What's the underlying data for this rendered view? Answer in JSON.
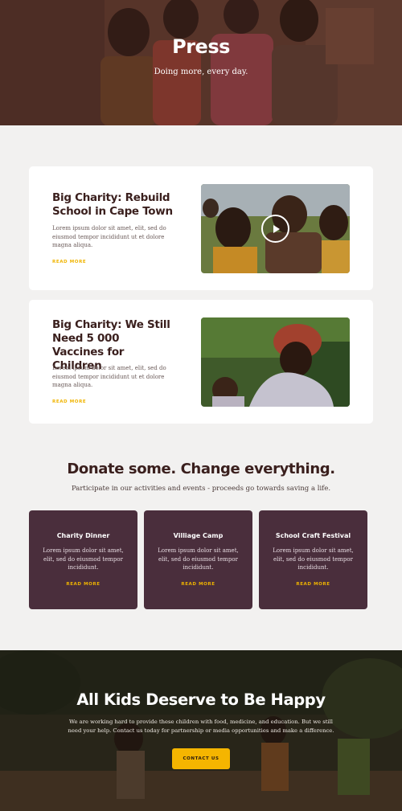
{
  "hero": {
    "title": "Press",
    "subtitle": "Doing more, every day."
  },
  "articles": [
    {
      "title": "Big Charity: Rebuild School in Cape Town",
      "body": "Lorem ipsum dolor sit amet, elit, sed do eiusmod tempor incididunt ut et dolore magna aliqua.",
      "link": "READ MORE",
      "media": "video"
    },
    {
      "title": "Big Charity: We Still Need 5 000 Vaccines for Children",
      "body": "Lorem ipsum dolor sit amet, elit, sed do eiusmod tempor incididunt ut et dolore magna aliqua.",
      "link": "READ MORE",
      "media": "image"
    }
  ],
  "donate": {
    "title": "Donate some. Change everything.",
    "subtitle": "Participate in our activities and events - proceeds go towards saving a life."
  },
  "events": [
    {
      "title": "Charity Dinner",
      "body": "Lorem ipsum dolor sit amet, elit, sed do eiusmod tempor incididunt.",
      "link": "READ MORE"
    },
    {
      "title": "Villiage Camp",
      "body": "Lorem ipsum dolor sit amet, elit, sed do eiusmod tempor incididunt.",
      "link": "READ MORE"
    },
    {
      "title": "School Craft Festival",
      "body": "Lorem ipsum dolor sit amet, elit, sed do eiusmod tempor incididunt.",
      "link": "READ MORE"
    }
  ],
  "cta": {
    "title": "All Kids Deserve to Be Happy",
    "text": "We are working hard to provide these children with food, medicine, and education. But we still need your help. Contact us today for partnership or media opportunities and make a difference.",
    "button": "CONTACT US"
  },
  "colors": {
    "accent": "#f5b500",
    "event_card": "#4a2e3c",
    "heading": "#3a1f1d",
    "page_bg": "#f2f1f0"
  },
  "icons": {
    "play": "play-icon"
  }
}
